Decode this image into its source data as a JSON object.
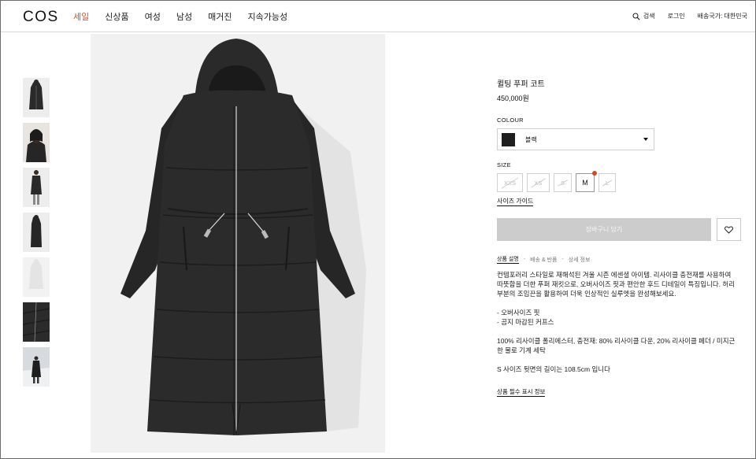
{
  "header": {
    "logo": "COS",
    "nav": [
      {
        "label": "세일"
      },
      {
        "label": "신상품"
      },
      {
        "label": "여성"
      },
      {
        "label": "남성"
      },
      {
        "label": "매거진"
      },
      {
        "label": "지속가능성"
      }
    ],
    "search_label": "검색",
    "login_label": "로그인",
    "shipping_label": "배송국가: 대한민국"
  },
  "colors": {
    "sale_accent": "#c8512b",
    "cart_button_bg": "#cccccc",
    "low_stock_dot": "#d2492a",
    "swatch": "#1f1f1f"
  },
  "product": {
    "title": "퀼팅 푸퍼 코트",
    "price": "450,000원",
    "colour_label": "COLOUR",
    "colour_value": "블랙",
    "size_label": "SIZE",
    "sizes": [
      {
        "label": "XXS",
        "available": false
      },
      {
        "label": "XS",
        "available": false
      },
      {
        "label": "S",
        "available": false
      },
      {
        "label": "M",
        "available": true,
        "selected": true
      },
      {
        "label": "L",
        "available": false
      }
    ],
    "size_guide": "사이즈 가이드",
    "add_to_cart": "장바구니 담기",
    "wishlist_icon": "heart-icon"
  },
  "tabs": [
    "상품 설명",
    "배송 & 반품",
    "상세 정보"
  ],
  "description": {
    "p1": "컨템포러리 스타일로 재해석된 겨울 시즌 에센셜 아이템. 리사이클 충전재를 사용하여 따뜻함을 더한 푸퍼 재킷으로, 오버사이즈 핏과 편안한 후드 디테일이 특징입니다. 허리 부분의 조임끈을 활용하여 더욱 인상적인 실루엣을 완성해보세요.",
    "bullet1": "- 오버사이즈 핏",
    "bullet2": "- 곰지 마감된 커프스",
    "p3": "100% 리사이클 폴리에스터, 충전재: 80% 리사이클 다운, 20% 리사이클 페더 / 미지근한 물로 기계 세탁",
    "p4": "S 사이즈 뒷면의 길이는 108.5cm 입니다",
    "info_link": "상품 필수 표시 정보"
  }
}
